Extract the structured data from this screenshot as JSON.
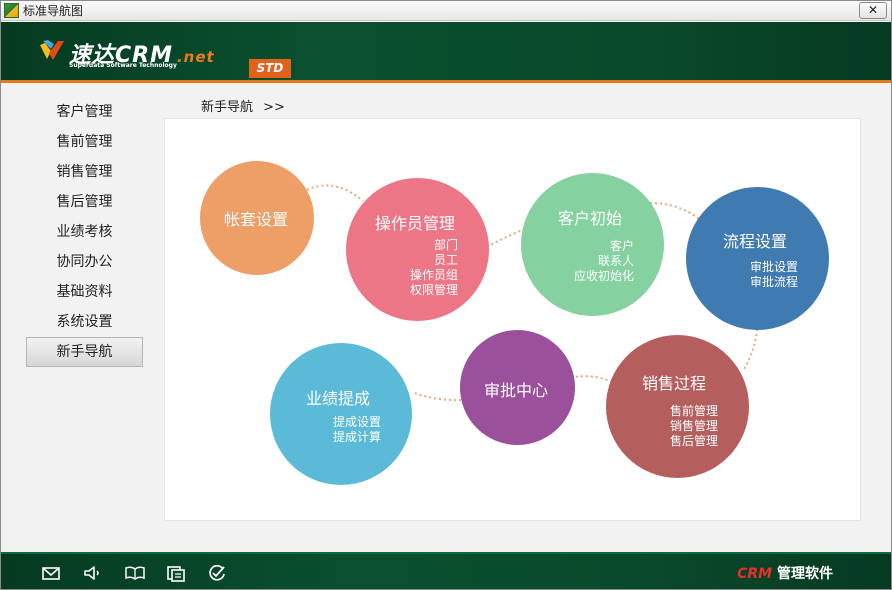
{
  "window": {
    "title": "标准导航图",
    "close_label": "✕"
  },
  "header": {
    "logo_cn": "速达CRM",
    "logo_net": ".net",
    "logo_en": "Superdata Software Technology",
    "logo_badge": "STD"
  },
  "sidebar": {
    "items": [
      {
        "label": "客户管理",
        "active": false
      },
      {
        "label": "售前管理",
        "active": false
      },
      {
        "label": "销售管理",
        "active": false
      },
      {
        "label": "售后管理",
        "active": false
      },
      {
        "label": "业绩考核",
        "active": false
      },
      {
        "label": "协同办公",
        "active": false
      },
      {
        "label": "基础资料",
        "active": false
      },
      {
        "label": "系统设置",
        "active": false
      },
      {
        "label": "新手导航",
        "active": true
      }
    ]
  },
  "breadcrumb": {
    "label": "新手导航",
    "arrow": ">>"
  },
  "nav": {
    "account": {
      "title": "帐套设置",
      "color": "#ee9e67"
    },
    "operator": {
      "title": "操作员管理",
      "items": [
        "部门",
        "员工",
        "操作员组",
        "权限管理"
      ],
      "color": "#ed7686"
    },
    "customer_init": {
      "title": "客户初始",
      "items": [
        "客户",
        "联系人",
        "应收初始化"
      ],
      "color": "#85d1a0"
    },
    "workflow": {
      "title": "流程设置",
      "items": [
        "审批设置",
        "审批流程"
      ],
      "color": "#3f7ab0"
    },
    "sales_process": {
      "title": "销售过程",
      "items": [
        "售前管理",
        "销售管理",
        "售后管理"
      ],
      "color": "#b45e5e"
    },
    "approval": {
      "title": "审批中心",
      "color": "#9a509b"
    },
    "commission": {
      "title": "业绩提成",
      "items": [
        "提成设置",
        "提成计算"
      ],
      "color": "#5bbad7"
    }
  },
  "footer": {
    "icons": [
      "mail-icon",
      "speaker-icon",
      "book-icon",
      "document-icon",
      "check-circle-icon"
    ],
    "brand_crm": "CRM",
    "brand_text": "管理软件"
  },
  "colors": {
    "header_green": "#0a4a2c",
    "accent_orange": "#e07a1a",
    "link_dots": "#e8a877"
  }
}
